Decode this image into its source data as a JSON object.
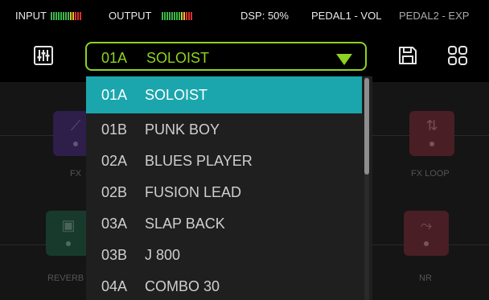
{
  "status": {
    "input_label": "INPUT",
    "output_label": "OUTPUT",
    "dsp": "DSP: 50%",
    "pedal1": "PEDAL1 - VOL",
    "pedal2": "PEDAL2 - EXP"
  },
  "toolbar": {
    "mixer_icon": "sliders-icon",
    "save_icon": "floppy-disk-icon",
    "grid_icon": "grid-icon"
  },
  "preset": {
    "current_code": "01A",
    "current_name": "SOLOIST"
  },
  "dropdown": {
    "items": [
      {
        "code": "01A",
        "name": "SOLOIST"
      },
      {
        "code": "01B",
        "name": "PUNK BOY"
      },
      {
        "code": "02A",
        "name": "BLUES PLAYER"
      },
      {
        "code": "02B",
        "name": "FUSION LEAD"
      },
      {
        "code": "03A",
        "name": "SLAP BACK"
      },
      {
        "code": "03B",
        "name": "J 800"
      },
      {
        "code": "04A",
        "name": "COMBO 30"
      }
    ]
  },
  "chain": {
    "fx_label": "FX",
    "fx_loop_label": "FX LOOP",
    "reverb_label": "REVERB",
    "nr_label": "NR"
  },
  "colors": {
    "accent_green": "#8ed321",
    "selected_teal": "#1ba6ad",
    "meter_green": "#3bb54a",
    "meter_red": "#e0302a"
  }
}
